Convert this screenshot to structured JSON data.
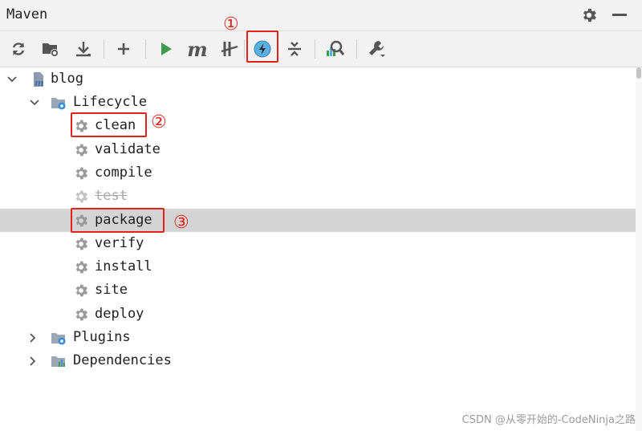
{
  "header": {
    "title": "Maven"
  },
  "toolbar": {
    "buttons": [
      {
        "name": "reload-icon"
      },
      {
        "name": "generate-sources-icon"
      },
      {
        "name": "download-icon"
      },
      {
        "name": "add-icon"
      },
      {
        "name": "run-icon"
      },
      {
        "name": "execute-goal-icon",
        "glyph": "m"
      },
      {
        "name": "toggle-offline-icon"
      },
      {
        "name": "skip-tests-icon"
      },
      {
        "name": "collapse-all-icon"
      },
      {
        "name": "analyze-dependencies-icon"
      },
      {
        "name": "settings-wrench-icon"
      }
    ]
  },
  "annotations": {
    "one": "①",
    "two": "②",
    "three": "③"
  },
  "tree": {
    "project": "blog",
    "lifecycle": "Lifecycle",
    "goals": [
      "clean",
      "validate",
      "compile",
      "test",
      "package",
      "verify",
      "install",
      "site",
      "deploy"
    ],
    "plugins": "Plugins",
    "dependencies": "Dependencies"
  },
  "colors": {
    "accent_red": "#e0231b",
    "run_green": "#3f9b4a",
    "selected_row": "#d4d4d4",
    "toggle_blue": "#5ab0e0"
  },
  "watermark": "CSDN @从零开始的-CodeNinja之路"
}
